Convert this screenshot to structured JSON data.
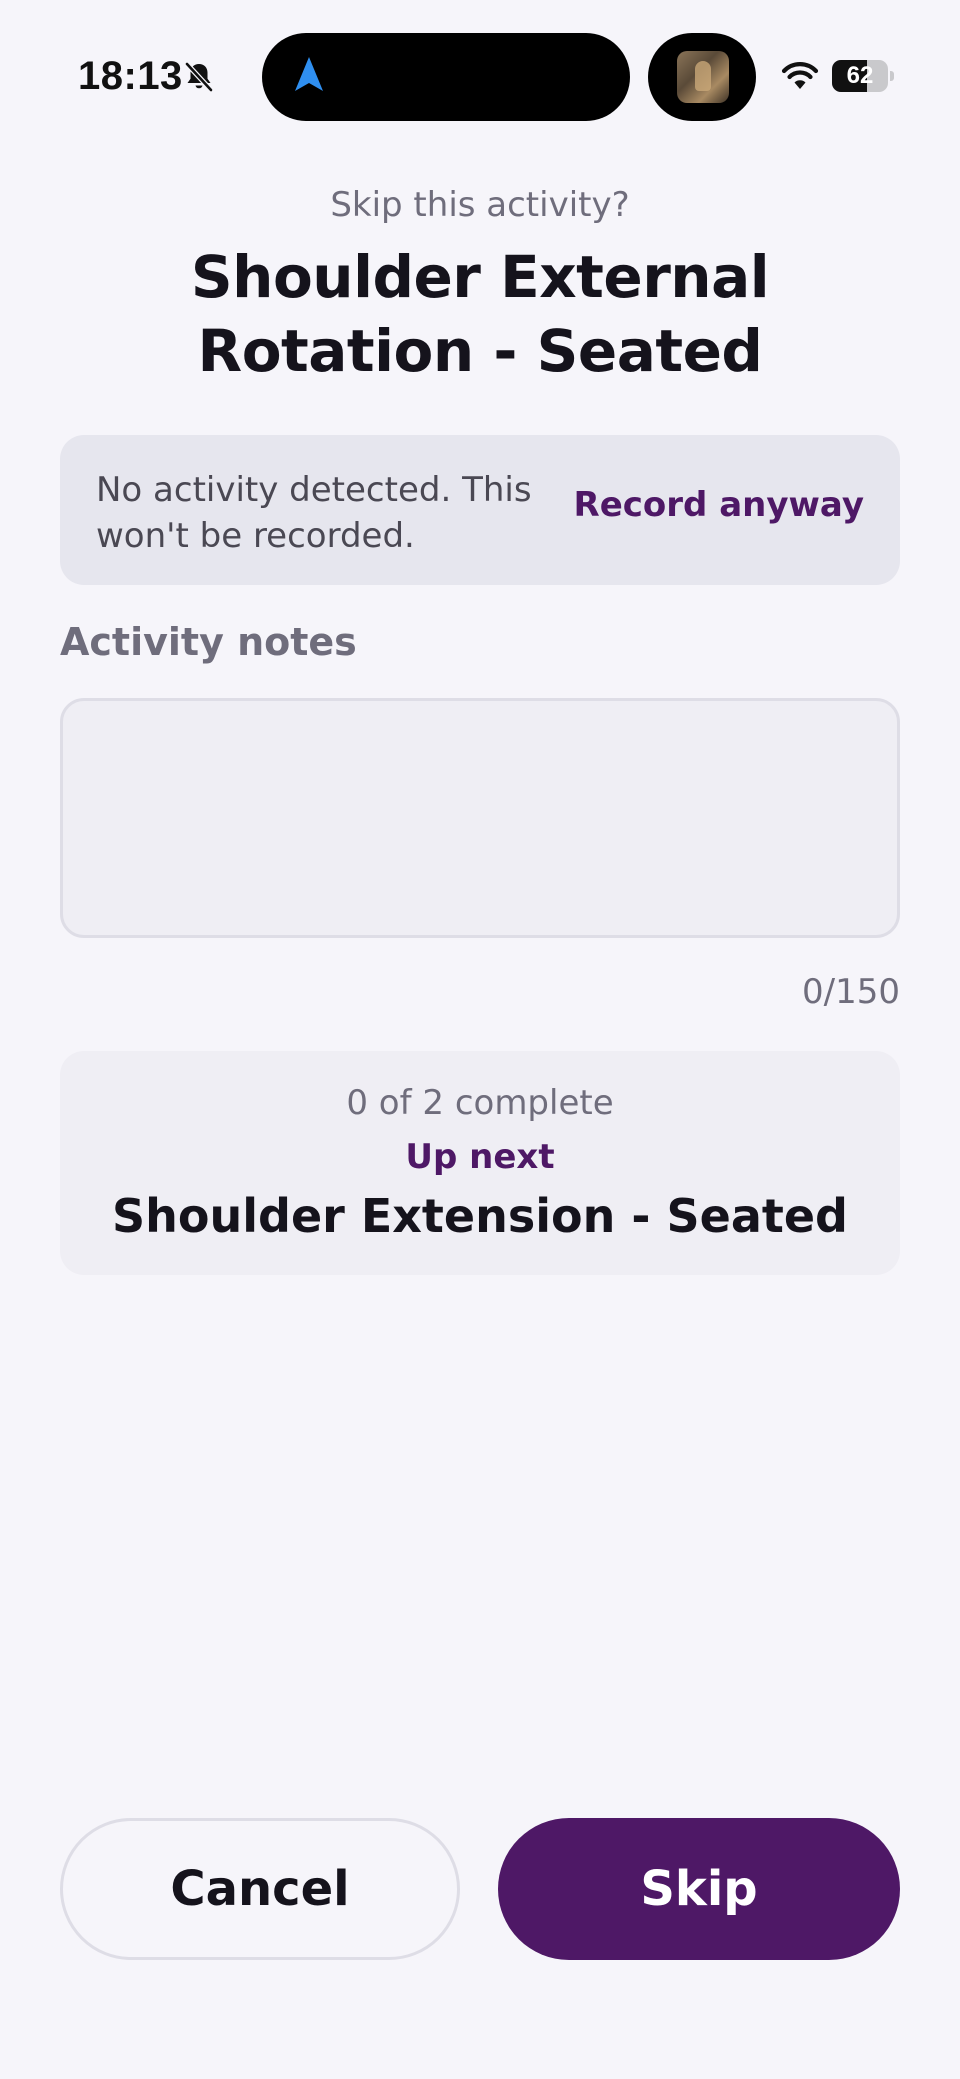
{
  "status_bar": {
    "time": "18:13",
    "battery_level": "62",
    "battery_fraction": 0.62,
    "icons": [
      "bell-slash-icon",
      "navigation-arrow-icon",
      "wifi-icon",
      "battery-icon"
    ]
  },
  "header": {
    "subtitle": "Skip this activity?",
    "title": "Shoulder External Rotation - Seated"
  },
  "detection": {
    "message": "No activity detected. This won't be recorded.",
    "action_label": "Record anyway"
  },
  "notes": {
    "label": "Activity notes",
    "value": "",
    "placeholder": "",
    "char_count": "0/150"
  },
  "progress": {
    "count_text": "0 of 2 complete",
    "up_next_label": "Up next",
    "next_activity": "Shoulder Extension - Seated"
  },
  "actions": {
    "cancel_label": "Cancel",
    "skip_label": "Skip"
  },
  "colors": {
    "accent": "#4e1866",
    "background": "#f6f5fa",
    "banner": "#e6e6ee",
    "card": "#efeef4",
    "muted_text": "#6f6d7c"
  }
}
